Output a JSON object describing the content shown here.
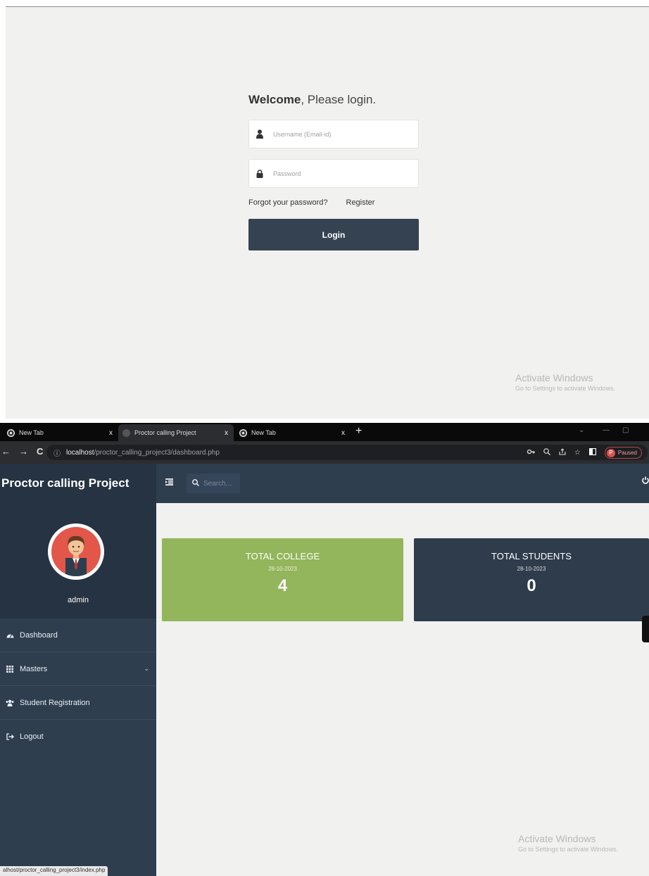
{
  "login": {
    "welcome_bold": "Welcome",
    "welcome_rest": ", Please login.",
    "username_placeholder": "Username (Email-id)",
    "password_placeholder": "Password",
    "forgot_label": "Forgot your password?",
    "register_label": "Register",
    "login_button": "Login"
  },
  "activate_windows": {
    "title": "Activate Windows",
    "subtitle": "Go to Settings to activate Windows."
  },
  "browser": {
    "tabs": [
      {
        "label": "New Tab",
        "close": "x"
      },
      {
        "label": "Proctor calling Project",
        "close": "x"
      },
      {
        "label": "New Tab",
        "close": "x"
      }
    ],
    "new_tab": "+",
    "url_info_icon": "ⓘ",
    "url_host": "localhost",
    "url_path": "/proctor_calling_project3/dashboard.php",
    "profile_initial": "P",
    "profile_status": "Paused",
    "status_url": "alhost/proctor_calling_project3/index.php"
  },
  "app": {
    "brand": "Proctor calling Project",
    "search_placeholder": "Search...",
    "user_name": "admin",
    "sidebar": [
      {
        "label": "Dashboard",
        "icon": "dashboard-icon"
      },
      {
        "label": "Masters",
        "icon": "grid-icon"
      },
      {
        "label": "Student Registration",
        "icon": "users-icon"
      },
      {
        "label": "Logout",
        "icon": "logout-icon"
      }
    ],
    "cards": [
      {
        "title": "TOTAL COLLEGE",
        "date": "28-10-2023",
        "value": "4",
        "color": "#93b55b"
      },
      {
        "title": "TOTAL STUDENTS",
        "date": "28-10-2023",
        "value": "0",
        "color": "#2e3c4c"
      }
    ]
  }
}
